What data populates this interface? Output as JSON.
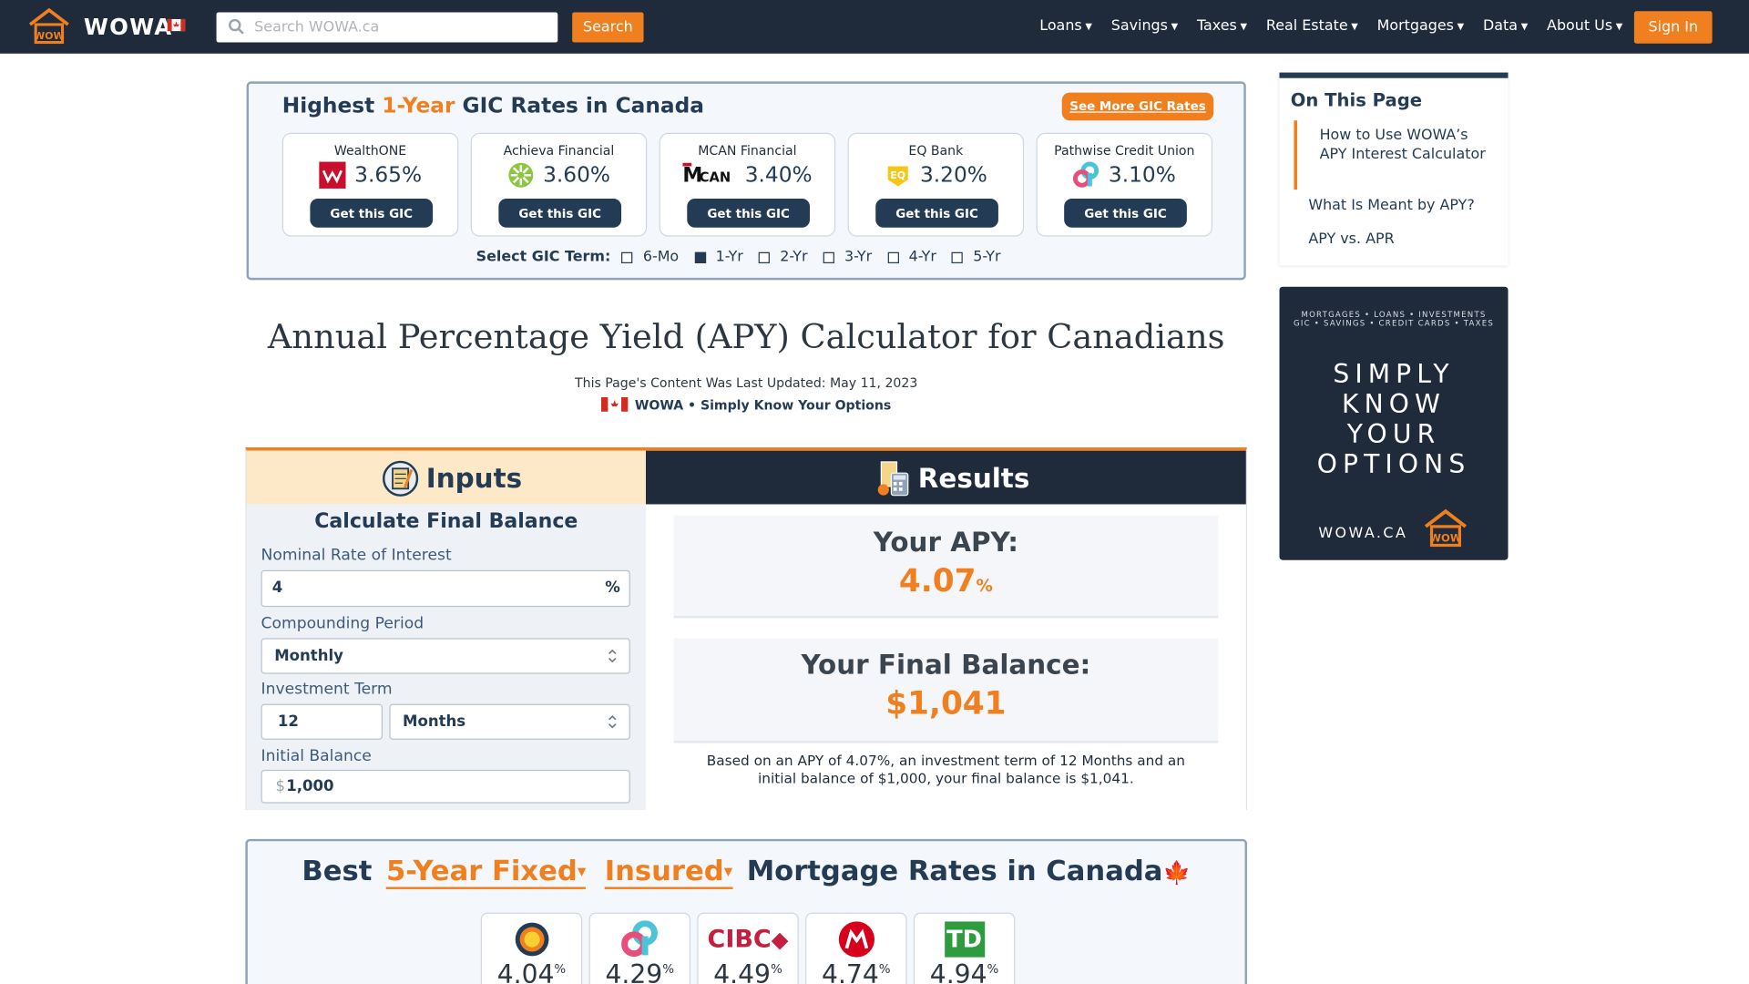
{
  "nav": {
    "brand": "WOWA",
    "search_placeholder": "Search WOWA.ca",
    "search_button": "Search",
    "menu": [
      "Loans",
      "Savings",
      "Taxes",
      "Real Estate",
      "Mortgages",
      "Data",
      "About Us"
    ],
    "sign_in": "Sign In"
  },
  "gic": {
    "title_pre": "Highest",
    "title_hl": "1-Year",
    "title_post": "GIC Rates in Canada",
    "see_more": "See More GIC Rates",
    "cards": [
      {
        "bank": "WealthONE",
        "rate": "3.65%",
        "button": "Get this GIC",
        "logo": "wealthone-logo"
      },
      {
        "bank": "Achieva Financial",
        "rate": "3.60%",
        "button": "Get this GIC",
        "logo": "achieva-logo"
      },
      {
        "bank": "MCAN Financial",
        "rate": "3.40%",
        "button": "Get this GIC",
        "logo": "mcan-logo"
      },
      {
        "bank": "EQ Bank",
        "rate": "3.20%",
        "button": "Get this GIC",
        "logo": "eq-bank-logo"
      },
      {
        "bank": "Pathwise Credit Union",
        "rate": "3.10%",
        "button": "Get this GIC",
        "logo": "pathwise-logo"
      }
    ],
    "term_label": "Select GIC Term:",
    "terms": [
      {
        "label": "6-Mo",
        "checked": false
      },
      {
        "label": "1-Yr",
        "checked": true
      },
      {
        "label": "2-Yr",
        "checked": false
      },
      {
        "label": "3-Yr",
        "checked": false
      },
      {
        "label": "4-Yr",
        "checked": false
      },
      {
        "label": "5-Yr",
        "checked": false
      }
    ]
  },
  "page": {
    "title": "Annual Percentage Yield (APY) Calculator for Canadians",
    "updated": "This Page's Content Was Last Updated: May 11, 2023",
    "tagline": "WOWA • Simply Know Your Options"
  },
  "calculator": {
    "inputs_header": "Inputs",
    "results_header": "Results",
    "subtitle": "Calculate Final Balance",
    "nominal_label": "Nominal Rate of Interest",
    "nominal_value": "4",
    "nominal_unit": "%",
    "compounding_label": "Compounding Period",
    "compounding_value": "Monthly",
    "term_label": "Investment Term",
    "term_value": "12",
    "term_unit": "Months",
    "initial_label": "Initial Balance",
    "initial_prefix": "$",
    "initial_value": "1,000",
    "apy_label": "Your APY:",
    "apy_value": "4.07",
    "apy_unit": "%",
    "balance_label": "Your Final Balance:",
    "balance_value": "$1,041",
    "explanation": "Based on an APY of 4.07%, an investment term of 12 Months and an initial balance of $1,000, your final balance is $1,041."
  },
  "mortgage": {
    "title_pre": "Best",
    "term_select": "5-Year Fixed",
    "type_select": "Insured",
    "title_post": "Mortgage Rates in Canada",
    "rates": [
      {
        "logo": "ring-logo",
        "rate": "4.04"
      },
      {
        "logo": "pathwise-logo",
        "rate": "4.29"
      },
      {
        "logo": "cibc-logo",
        "rate": "4.49"
      },
      {
        "logo": "bmo-logo",
        "rate": "4.74"
      },
      {
        "logo": "td-logo",
        "rate": "4.94"
      }
    ],
    "rate_unit": "%",
    "cibc_text": "CIBC",
    "td_text": "TD"
  },
  "sidebar": {
    "toc_title": "On This Page",
    "toc_items": [
      "How to Use WOWA’s APY Interest Calculator",
      "What Is Meant by APY?",
      "APY vs. APR"
    ],
    "ad_top_1": "MORTGAGES • LOANS • INVESTMENTS",
    "ad_top_2": "GIC • SAVINGS • CREDIT CARDS • TAXES",
    "ad_main": [
      "SIMPLY",
      "KNOW",
      "YOUR",
      "OPTIONS"
    ],
    "ad_url": "WOWA.CA"
  },
  "colors": {
    "accent": "#f0801f",
    "navy": "#243b55",
    "nav_bg": "#1f2a3a"
  }
}
